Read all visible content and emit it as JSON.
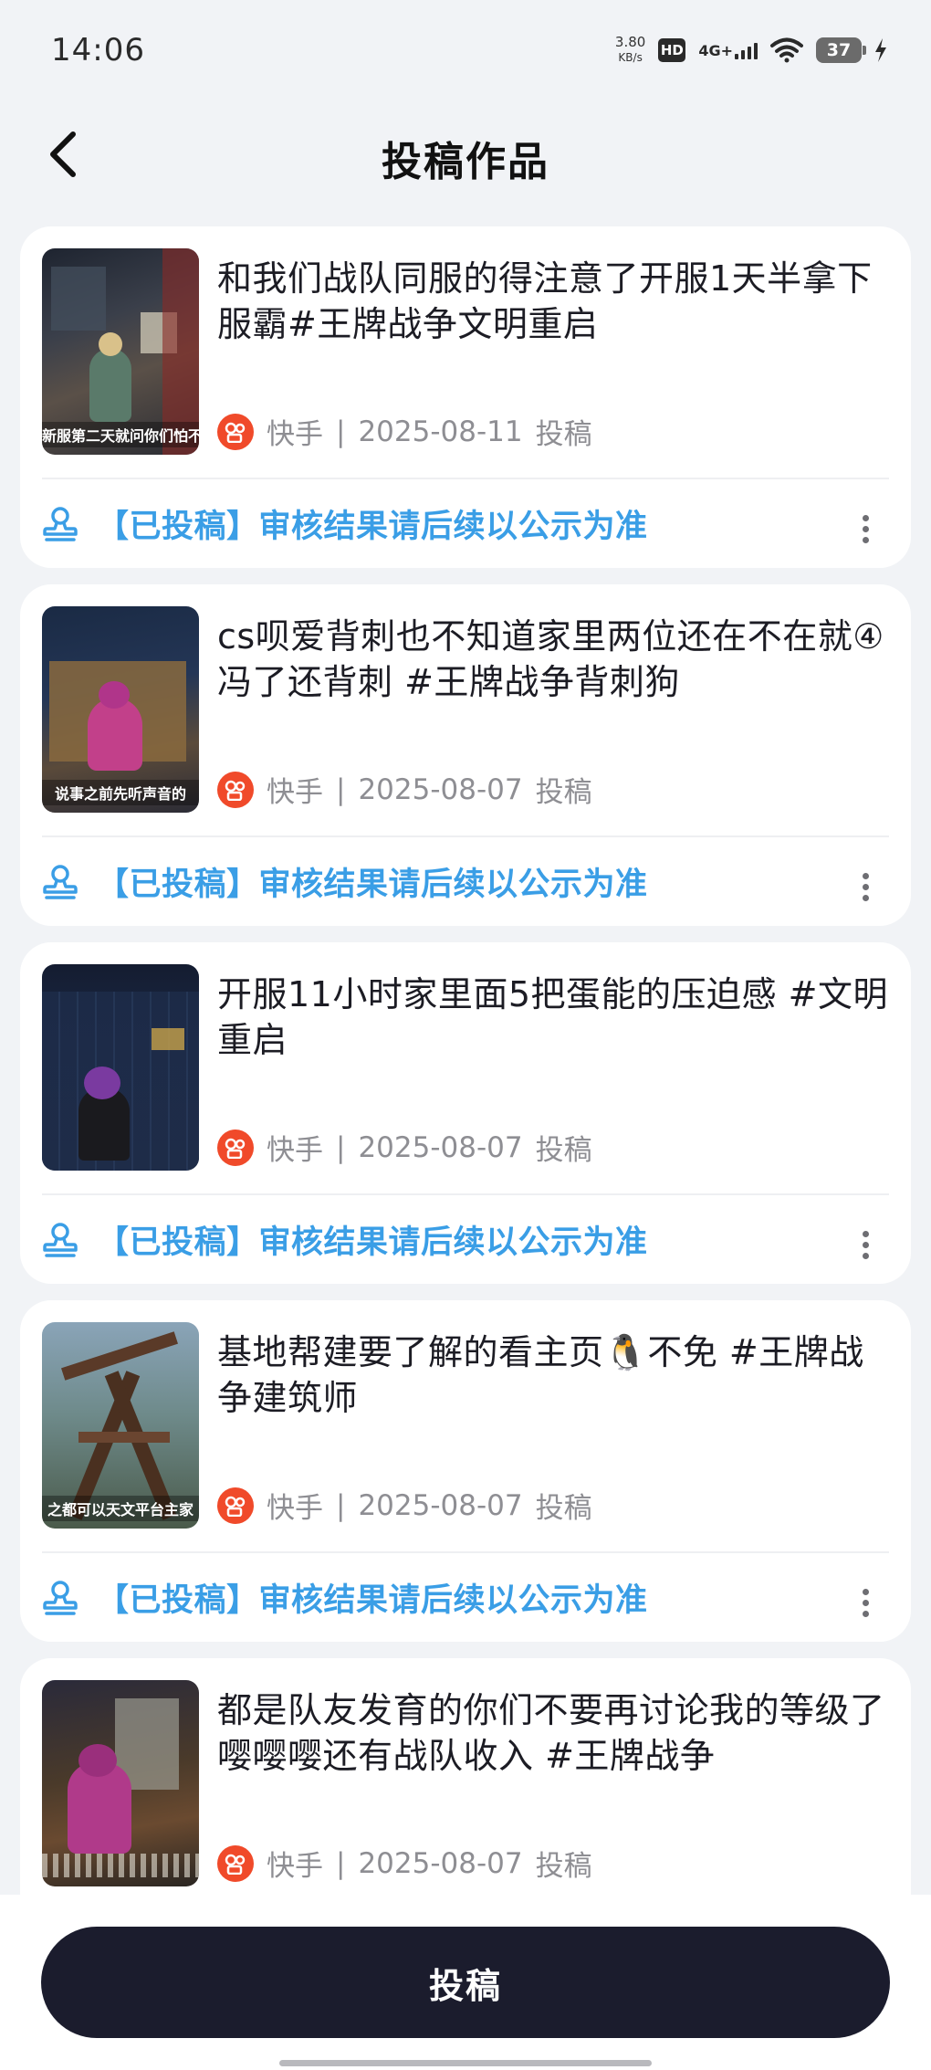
{
  "status_bar": {
    "time": "14:06",
    "net_speed_value": "3.80",
    "net_speed_unit": "KB/s",
    "hd_label": "HD",
    "network_label": "4G+",
    "battery_level": "37"
  },
  "header": {
    "title": "投稿作品",
    "back_icon": "chevron-left-icon"
  },
  "cards": [
    {
      "title": "和我们战队同服的得注意了开服1天半拿下服霸#王牌战争文明重启",
      "platform": "快手",
      "date": "2025-08-11",
      "meta_suffix": "投稿",
      "status": "【已投稿】审核结果请后续以公示为准",
      "thumb_caption": "新服第二天就问你们怕不怕老弟"
    },
    {
      "title": "cs呗爱背刺也不知道家里两位还在不在就④冯了还背刺 #王牌战争背刺狗",
      "platform": "快手",
      "date": "2025-08-07",
      "meta_suffix": "投稿",
      "status": "【已投稿】审核结果请后续以公示为准",
      "thumb_caption": "说事之前先听声音的"
    },
    {
      "title": "开服11小时家里面5把蛋能的压迫感 #文明重启",
      "platform": "快手",
      "date": "2025-08-07",
      "meta_suffix": "投稿",
      "status": "【已投稿】审核结果请后续以公示为准",
      "thumb_caption": ""
    },
    {
      "title": "基地帮建要了解的看主页🐧不免 #王牌战争建筑师",
      "platform": "快手",
      "date": "2025-08-07",
      "meta_suffix": "投稿",
      "status": "【已投稿】审核结果请后续以公示为准",
      "thumb_caption": "之都可以天文平台主家"
    },
    {
      "title": "都是队友发育的你们不要再讨论我的等级了嘤嘤嘤还有战队收入 #王牌战争",
      "platform": "快手",
      "date": "2025-08-07",
      "meta_suffix": "投稿",
      "status": "",
      "thumb_caption": ""
    }
  ],
  "footer": {
    "submit_label": "投稿"
  },
  "colors": {
    "status_blue": "#3a9ee6",
    "kuaishou_orange": "#f04a2a",
    "button_dark": "#1b1c2d"
  }
}
